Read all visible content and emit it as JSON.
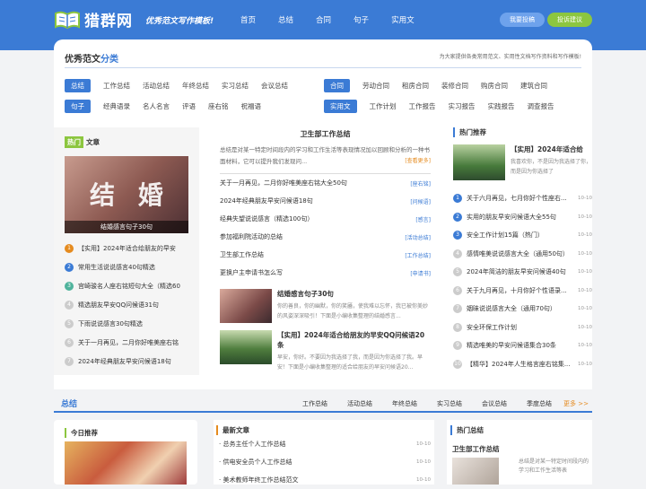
{
  "header": {
    "site_name": "猎群网",
    "slogan": "优秀范文写作模板!",
    "nav": [
      "首页",
      "总结",
      "合同",
      "句子",
      "实用文"
    ],
    "submit_button": "我要投稿",
    "suggest_button": "投诉建议",
    "brand_color": "#3b7bd5"
  },
  "categories": {
    "title_prefix": "优秀范文",
    "title_highlight": "分类",
    "description": "为大家提供各类常用范文、实用性文档写作资料和写作模板!",
    "row1_left": {
      "main": "总结",
      "items": [
        "工作总结",
        "活动总结",
        "年终总结",
        "实习总结",
        "会议总结"
      ]
    },
    "row1_right": {
      "main": "合同",
      "items": [
        "劳动合同",
        "租房合同",
        "装修合同",
        "购房合同",
        "建筑合同"
      ]
    },
    "row2_left": {
      "main": "句子",
      "items": [
        "经典语录",
        "名人名言",
        "评语",
        "座右铭",
        "祝福语"
      ]
    },
    "row2_right": {
      "main": "实用文",
      "items": [
        "工作计划",
        "工作报告",
        "实习报告",
        "实践报告",
        "调查报告"
      ]
    }
  },
  "hot": {
    "label1": "热门",
    "label2": "文章",
    "image_text": "结 婚",
    "image_caption": "结婚感言句子30句",
    "items": [
      "【实用】2024年适合给朋友的早安",
      "常用生活说说感言40句精选",
      "宫崎骏名人座右铭短句大全（精选60",
      "精选朋友早安QQ问候语31句",
      "下雨说说感言30句精选",
      "关于一月再见，二月你好唯美座右铭",
      "2024年经典朋友早安问候语18句"
    ],
    "num_colors": [
      "#e58b1f",
      "#3b7bd5",
      "#4fb39c",
      "#bbbbbb",
      "#bbbbbb",
      "#bbbbbb",
      "#bbbbbb"
    ]
  },
  "middle": {
    "title": "卫生部工作总结",
    "summary": "总结是对某一特定时间段内的学习和工作生活等表现情况加以回顾和分析的一种书面材料，它可以提升我们发现问...",
    "more": "[查看更多]",
    "list": [
      {
        "title": "关于一月再见，二月你好唯美座右铭大全50句",
        "cat": "[座右铭]"
      },
      {
        "title": "2024年经典朋友早安问候语18句",
        "cat": "[问候语]"
      },
      {
        "title": "经典失望说说感言（精选100句）",
        "cat": "[感言]"
      },
      {
        "title": "参加福利院活动的总结",
        "cat": "[活动总结]"
      },
      {
        "title": "卫生部工作总结",
        "cat": "[工作总结]"
      },
      {
        "title": "更换户主申请书怎么写",
        "cat": "[申请书]"
      }
    ],
    "feature1": {
      "title": "结婚感言句子30句",
      "desc": "你的善良，你的幽默，你的笑靥，使我难以忘怀，我已被你美妙的风姿深深吸引！下面是小编收集整理的结婚感言..."
    },
    "feature2": {
      "title": "【实用】2024年适合给朋友的早安QQ问候语20条",
      "desc": "早安，你好。不要因为我选择了我，而是因为你选择了我。早安！下面是小编收集整理的适合给朋友的早安问候语20..."
    }
  },
  "right": {
    "heading": "热门推荐",
    "feature": {
      "title": "【实用】2024年适合给",
      "desc": "我喜欢你，不是因为我选择了你，而是因为你选择了"
    },
    "items": [
      {
        "t": "关于六月再见，七月你好个性座右...",
        "d": "10-10"
      },
      {
        "t": "实用的朋友早安问候语大全55句",
        "d": "10-10"
      },
      {
        "t": "安全工作计划15篇（热门）",
        "d": "10-10"
      },
      {
        "t": "感情唯美说说感言大全（通用50句）",
        "d": "10-10"
      },
      {
        "t": "2024年简洁的朋友早安问候语40句",
        "d": "10-10"
      },
      {
        "t": "关于九月再见，十月你好个性语录...",
        "d": "10-10"
      },
      {
        "t": "姻昧说说感言大全（通用70句）",
        "d": "10-10"
      },
      {
        "t": "安全环保工作计划",
        "d": "10-10"
      },
      {
        "t": "精选唯美的早安问候语集合30条",
        "d": "10-10"
      },
      {
        "t": "【精华】2024年人生格言座右铭集...",
        "d": "10-10"
      }
    ],
    "num_colors": [
      "#3b7bd5",
      "#3b7bd5",
      "#3b7bd5",
      "#bbbbbb",
      "#bbbbbb",
      "#bbbbbb",
      "#bbbbbb",
      "#bbbbbb",
      "#bbbbbb",
      "#bbbbbb"
    ]
  },
  "section": {
    "title": "总结",
    "tabs": [
      "工作总结",
      "活动总结",
      "年终总结",
      "实习总结",
      "会议总结",
      "季度总结"
    ],
    "more": "更多 >>"
  },
  "bottom": {
    "today": "今日推荐",
    "latest": "最新文章",
    "latest_items": [
      {
        "t": "总务主任个人工作总结",
        "d": "10-10"
      },
      {
        "t": "供电安全员个人工作总结",
        "d": "10-10"
      },
      {
        "t": "美术教师年终工作总结范文",
        "d": "10-10"
      }
    ],
    "hot_summary": "热门总结",
    "hot_title": "卫生部工作总结",
    "hot_desc": "总结是对某一特定时间段内的学习和工作生活等表"
  }
}
